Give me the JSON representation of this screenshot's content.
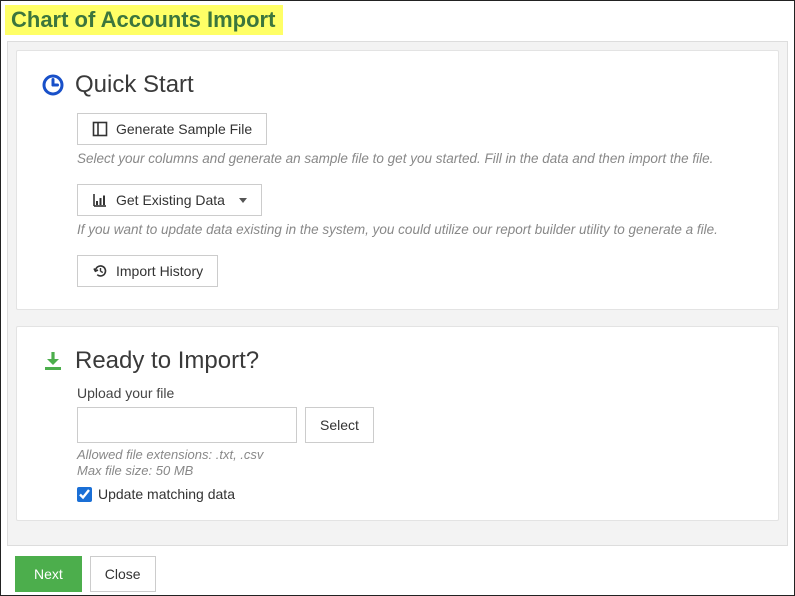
{
  "page_title": "Chart of Accounts Import",
  "quick_start": {
    "title": "Quick Start",
    "generate_sample_label": "Generate Sample File",
    "generate_sample_help": "Select your columns and generate an sample file to get you started. Fill in the data and then import the file.",
    "get_existing_label": "Get Existing Data",
    "get_existing_help": "If you want to update data existing in the system, you could utilize our report builder utility to generate a file.",
    "import_history_label": "Import History"
  },
  "ready_import": {
    "title": "Ready to Import?",
    "upload_label": "Upload your file",
    "file_value": "",
    "select_label": "Select",
    "allowed_ext": "Allowed file extensions: .txt, .csv",
    "max_size": "Max file size: 50 MB",
    "update_matching_label": "Update matching data",
    "update_matching_checked": true
  },
  "footer": {
    "next_label": "Next",
    "close_label": "Close"
  }
}
